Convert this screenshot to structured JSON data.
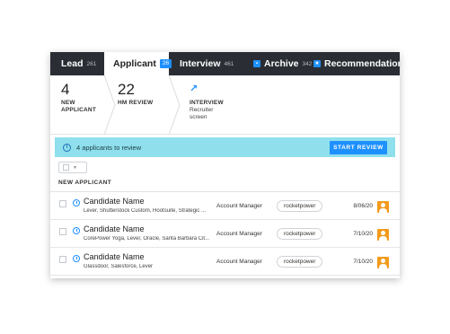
{
  "tabs": [
    {
      "label": "Lead",
      "count": "261"
    },
    {
      "label": "Applicant",
      "count": "26"
    },
    {
      "label": "Interview",
      "count": "461"
    },
    {
      "label": "Archive",
      "count": "342"
    },
    {
      "label": "Recommendations",
      "count": ""
    }
  ],
  "stages": {
    "new_applicant": {
      "count": "4",
      "label_line1": "NEW",
      "label_line2": "APPLICANT"
    },
    "hm_review": {
      "count": "22",
      "label": "HM REVIEW"
    },
    "interview": {
      "label": "INTERVIEW",
      "sub_line1": "Recruiter",
      "sub_line2": "screen"
    }
  },
  "banner": {
    "text": "4 applicants to review",
    "button": "START REVIEW"
  },
  "section": {
    "title": "NEW APPLICANT"
  },
  "candidates": [
    {
      "name": "Candidate Name",
      "sources": "Lever, Shutterstock Custom, Hootsuite, Strategic ...",
      "job": "Account Manager",
      "tag": "rocketpower",
      "date": "8/06/20"
    },
    {
      "name": "Candidate Name",
      "sources": "CorePower Yoga, Lever, Oracle, Santa Barbara Cit...",
      "job": "Account Manager",
      "tag": "rocketpower",
      "date": "7/10/20"
    },
    {
      "name": "Candidate Name",
      "sources": "Glassdoor, Salesforce, Lever",
      "job": "Account Manager",
      "tag": "rocketpower",
      "date": "7/10/20"
    }
  ],
  "colors": {
    "accent": "#1e90ff",
    "tabbar": "#2a2d33",
    "banner": "#8fe0ec",
    "avatar": "#f39a1c"
  }
}
